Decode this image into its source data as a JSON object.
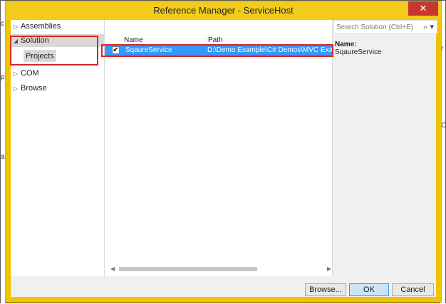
{
  "window": {
    "title": "Reference Manager - ServiceHost",
    "close_glyph": "✕"
  },
  "nav": {
    "items": [
      {
        "label": "Assemblies",
        "arrow": "▷"
      },
      {
        "label": "Solution",
        "arrow": "◢"
      },
      {
        "label": "COM",
        "arrow": "▷"
      },
      {
        "label": "Browse",
        "arrow": "▷"
      }
    ],
    "sub_item": "Projects"
  },
  "list": {
    "columns": [
      "Name",
      "Path"
    ],
    "rows": [
      {
        "checked": true,
        "check_glyph": "✔",
        "name": "SqaureService",
        "path": "D:\\Demo Example\\C# Demos\\MVC Example"
      }
    ]
  },
  "search": {
    "placeholder": "Search Solution (Ctrl+E)",
    "icon": "⌕ ▾"
  },
  "details": {
    "name_label": "Name:",
    "name_value": "SqaureService"
  },
  "buttons": {
    "browse": "Browse...",
    "ok": "OK",
    "cancel": "Cancel"
  },
  "scroll": {
    "left_glyph": "◀",
    "right_glyph": "▶"
  },
  "background_glyphs": {
    "left": [
      "c",
      "a",
      "p"
    ],
    "right": [
      "r",
      "C"
    ]
  },
  "colors": {
    "titlebar": "#f3cb1a",
    "close": "#c7372f",
    "selection": "#3399ff",
    "highlight": "#d62828"
  }
}
